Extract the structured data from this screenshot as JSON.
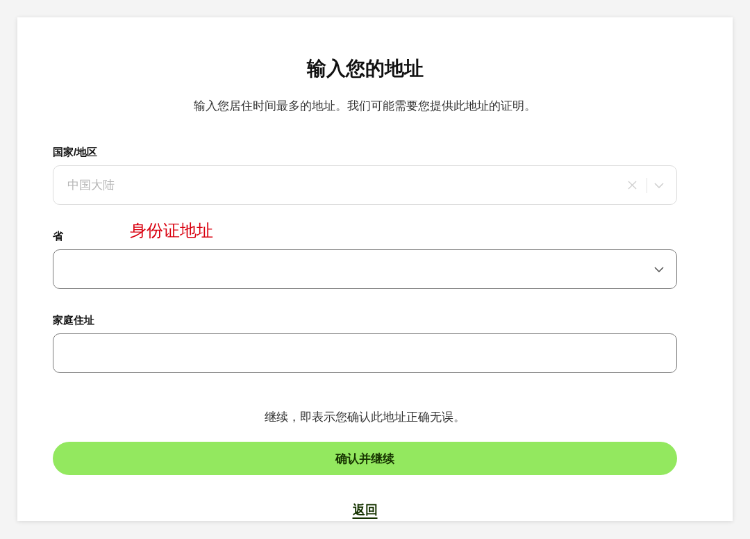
{
  "title": "输入您的地址",
  "subtitle": "输入您居住时间最多的地址。我们可能需要您提供此地址的证明。",
  "fields": [
    {
      "kind": "select",
      "label": "国家/地区",
      "value": "中国大陆",
      "disabled": true,
      "clearable": true
    },
    {
      "kind": "select",
      "label": "省",
      "annotation": "身份证地址",
      "disabled": false,
      "clearable": false
    },
    {
      "kind": "text",
      "label": "家庭住址",
      "disabled": false,
      "clearable": false
    }
  ],
  "consent_text": "继续，即表示您确认此地址正确无误。",
  "primary_button": "确认并继续",
  "back_link": "返回"
}
